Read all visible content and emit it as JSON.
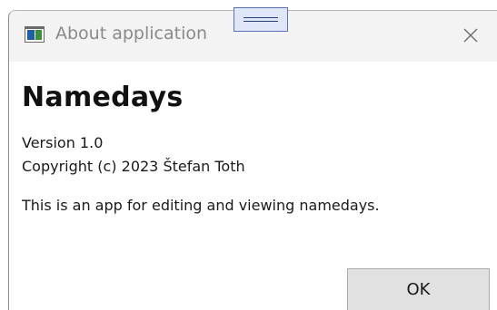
{
  "window": {
    "title": "About application",
    "icon": "app-window-icon",
    "close_icon": "close-icon"
  },
  "about": {
    "app_name": "Namedays",
    "version": "Version 1.0",
    "copyright": "Copyright (c) 2023 Štefan Toth",
    "description": "This is an app for editing and viewing namedays."
  },
  "buttons": {
    "ok_label": "OK"
  },
  "overlay": {
    "drag_handle_icon": "drag-handle-icon"
  },
  "colors": {
    "titlebar_bg": "#f3f3f3",
    "button_bg": "#e1e1e1",
    "handle_bg": "#dfe6f7",
    "handle_border": "#5a73b8"
  }
}
